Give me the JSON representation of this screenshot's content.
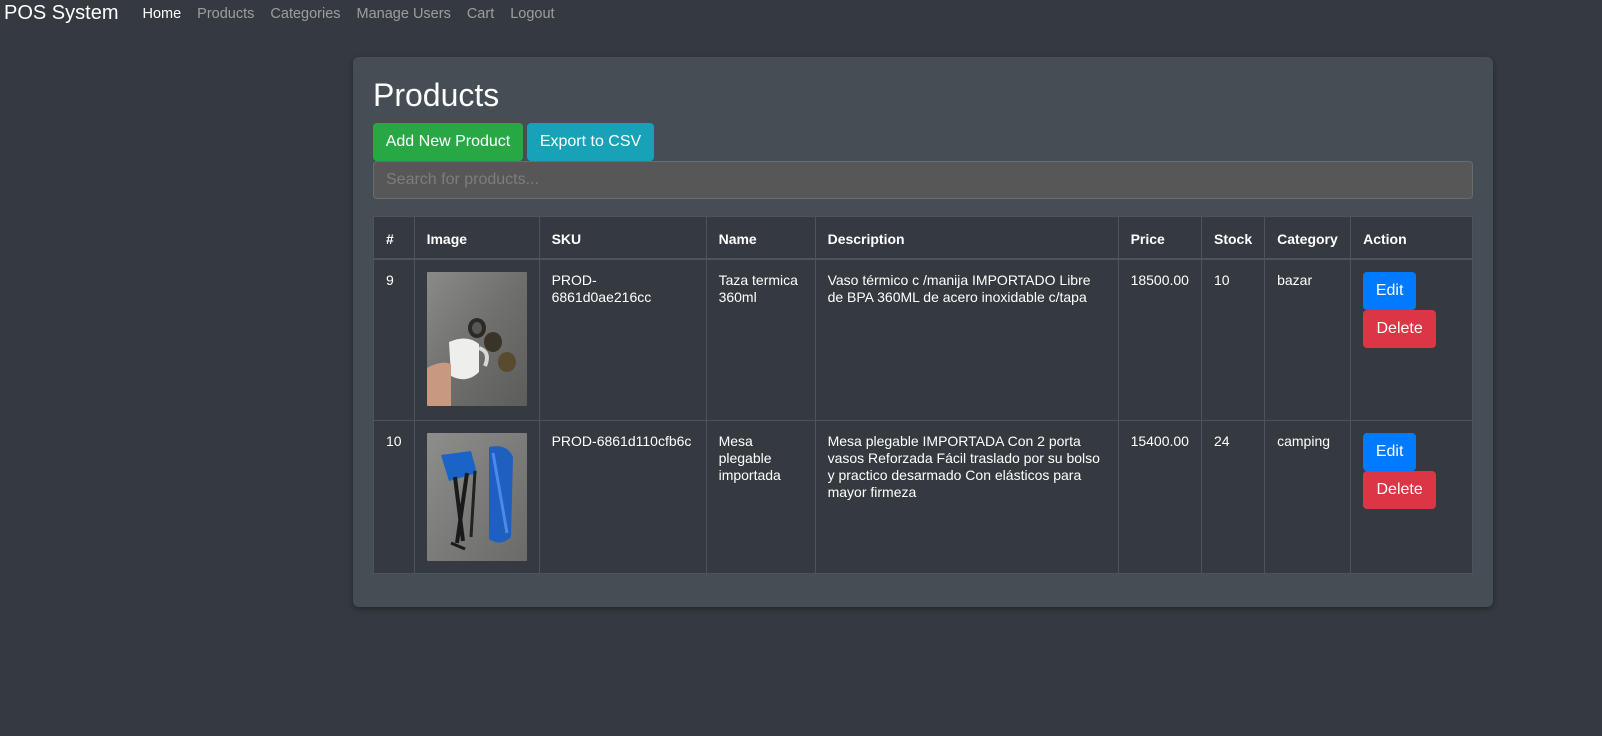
{
  "nav": {
    "brand": "POS System",
    "links": [
      "Home",
      "Products",
      "Categories",
      "Manage Users",
      "Cart",
      "Logout"
    ]
  },
  "main": {
    "title": "Products",
    "add_button": "Add New Product",
    "export_button": "Export to CSV",
    "search_placeholder": "Search for products..."
  },
  "table": {
    "headers": [
      "#",
      "Image",
      "SKU",
      "Name",
      "Description",
      "Price",
      "Stock",
      "Category",
      "Action"
    ],
    "rows": [
      {
        "id": "9",
        "image": "thermal-mug-photo",
        "sku": "PROD-6861d0ae216cc",
        "name": "Taza termica 360ml",
        "description": "Vaso térmico c /manija IMPORTADO Libre de BPA 360ML de acero inoxidable c/tapa",
        "price": "18500.00",
        "stock": "10",
        "category": "bazar",
        "edit": "Edit",
        "delete": "Delete"
      },
      {
        "id": "10",
        "image": "folding-table-photo",
        "sku": "PROD-6861d110cfb6c",
        "name": "Mesa plegable importada",
        "description": "Mesa plegable IMPORTADA Con 2 porta vasos Reforzada Fácil traslado por su bolso y practico desarmado Con elásticos para mayor firmeza",
        "price": "15400.00",
        "stock": "24",
        "category": "camping",
        "edit": "Edit",
        "delete": "Delete"
      }
    ]
  },
  "colors": {
    "background": "#343a40",
    "card": "#454d55",
    "success": "#28a745",
    "info": "#17a2b8",
    "primary": "#007bff",
    "danger": "#dc3545"
  }
}
